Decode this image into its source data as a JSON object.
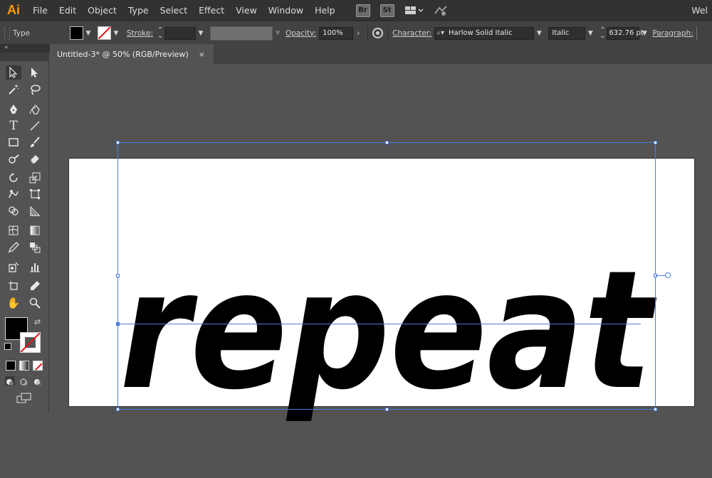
{
  "app": {
    "logo": "Ai",
    "workspace_label": "Wel"
  },
  "menu": [
    "File",
    "Edit",
    "Object",
    "Type",
    "Select",
    "Effect",
    "View",
    "Window",
    "Help"
  ],
  "app_buttons": {
    "bridge": "Br",
    "stock": "St"
  },
  "control_bar": {
    "mode_label": "Type",
    "stroke_label": "Stroke:",
    "opacity_label": "Opacity:",
    "opacity_value": "100%",
    "character_label": "Character:",
    "font_family": "Harlow Solid Italic",
    "font_style": "Italic",
    "font_size": "632.76 pt",
    "paragraph_label": "Paragraph:"
  },
  "panel_strip_label": "«",
  "document_tab": {
    "title": "Untitled-3* @ 50% (RGB/Preview)",
    "close": "×"
  },
  "artboard": {
    "text": "repeat"
  },
  "colors": {
    "accent": "#4a7ce0",
    "fill": "#000000",
    "stroke_none": "#e01515",
    "logo": "#ff9a00"
  },
  "icons": [
    "selection-icon",
    "direct-selection-icon",
    "magic-wand-icon",
    "lasso-icon",
    "pen-icon",
    "curvature-icon",
    "type-icon",
    "line-icon",
    "rectangle-icon",
    "paintbrush-icon",
    "shaper-icon",
    "eraser-icon",
    "rotate-icon",
    "scale-icon",
    "warp-icon",
    "free-transform-icon",
    "shape-builder-icon",
    "perspective-icon",
    "mesh-icon",
    "gradient-icon",
    "eyedropper-icon",
    "blend-icon",
    "symbol-sprayer-icon",
    "graph-icon",
    "artboard-icon",
    "slice-icon",
    "hand-icon",
    "zoom-icon"
  ]
}
